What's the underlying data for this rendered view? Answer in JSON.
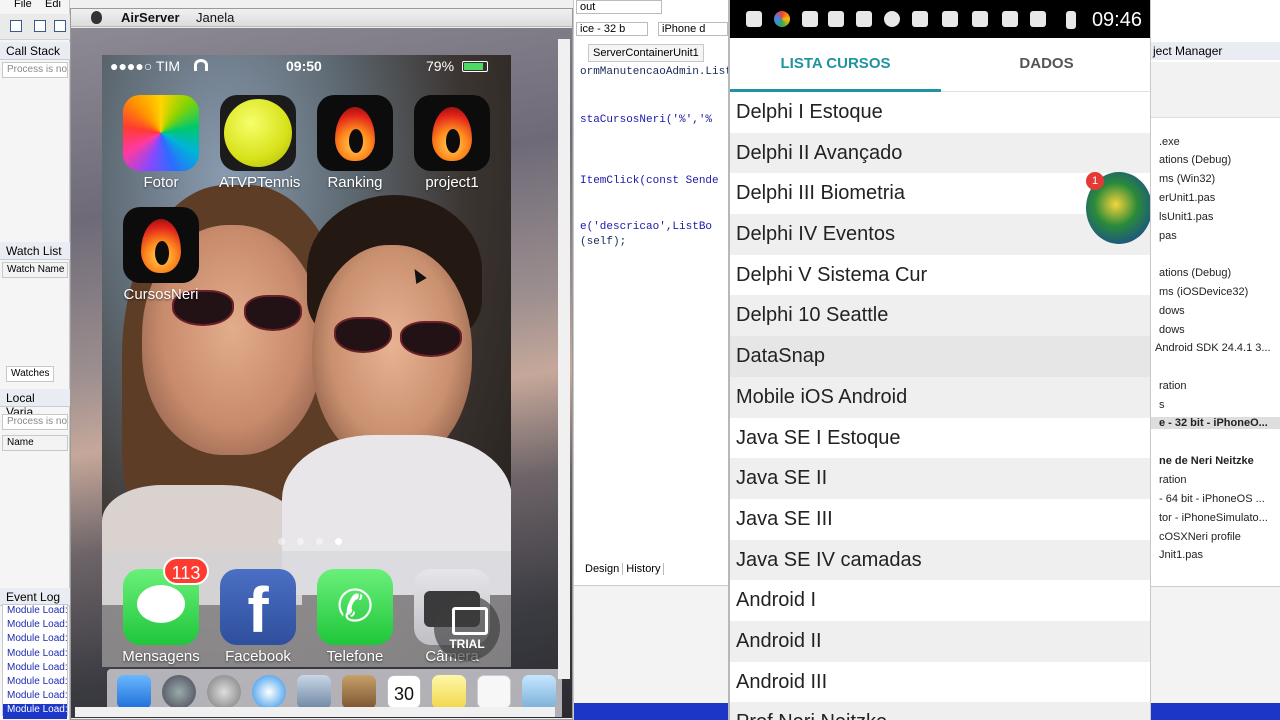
{
  "ide": {
    "menu": [
      "File",
      "Edi"
    ],
    "panels": {
      "call_stack": "Call Stack",
      "call_stack_sub": "Process is no",
      "watch_list": "Watch List",
      "watch_name": "Watch Name",
      "watches_tab": "Watches",
      "local_vars": "Local Varia",
      "local_vars_sub": "Process is no",
      "local_name": "Name",
      "event_log": "Event Log",
      "event_items": [
        "Module Load:",
        "Module Load:",
        "Module Load:",
        "Module Load:",
        "Module Load:",
        "Module Load:",
        "Module Load:",
        "Module Load:"
      ]
    },
    "center": {
      "combo1": "out",
      "combo2": "ice - 32 b",
      "combo3": "iPhone d",
      "tab": "ServerContainerUnit1",
      "code": [
        "ormManutencaoAdmin.ListBo",
        "staCursosNeri('%','%",
        "ItemClick(const Sende",
        "e('descricao',ListBo",
        "(self);"
      ],
      "design_tab": "Design",
      "history_tab": "History"
    },
    "project_manager": {
      "title": "ject Manager",
      "items": [
        ".exe",
        "ations (Debug)",
        "ms (Win32)",
        "erUnit1.pas",
        "lsUnit1.pas",
        "pas",
        "ations (Debug)",
        "ms (iOSDevice32)",
        "dows",
        "dows",
        "Android SDK 24.4.1 3...",
        "ration",
        "s",
        "e - 32 bit - iPhoneO...",
        "ne de Neri Neitzke",
        "ration",
        "- 64 bit - iPhoneOS ...",
        "tor - iPhoneSimulato...",
        "cOSXNeri profile",
        "Jnit1.pas"
      ]
    }
  },
  "airserver": {
    "app_name": "AirServer",
    "menu": "Janela",
    "status": {
      "carrier": "●●●●○ TIM",
      "time": "09:50",
      "battery": "79%"
    },
    "apps": [
      {
        "label": "Fotor",
        "icon": "fotor-icon"
      },
      {
        "label": "ATVPTennis",
        "icon": "tennis-ball-icon"
      },
      {
        "label": "Ranking",
        "icon": "flame-icon"
      },
      {
        "label": "project1",
        "icon": "flame-icon"
      },
      {
        "label": "CursosNeri",
        "icon": "flame-icon"
      }
    ],
    "dock": [
      {
        "label": "Mensagens",
        "icon": "messages-icon",
        "badge": "113"
      },
      {
        "label": "Facebook",
        "icon": "facebook-icon",
        "glyph": "f"
      },
      {
        "label": "Telefone",
        "icon": "phone-icon",
        "glyph": "✆"
      },
      {
        "label": "Câmera",
        "icon": "camera-icon"
      }
    ],
    "trial": "TRIAL",
    "mac_dock_calendar": "30"
  },
  "android": {
    "time": "09:46",
    "tabs": [
      "LISTA CURSOS",
      "DADOS"
    ],
    "courses": [
      "Delphi I Estoque",
      "Delphi II Avançado",
      "Delphi III Biometria",
      "Delphi IV Eventos",
      "Delphi V Sistema Cur",
      "Delphi 10 Seattle",
      "DataSnap",
      "Mobile iOS Android",
      "Java SE I Estoque",
      "Java SE II",
      "Java SE III",
      "Java SE IV camadas",
      "Android I",
      "Android II",
      "Android III",
      "Prof Neri Neitzke"
    ],
    "chat_badge": "1"
  },
  "colors": {
    "accent": "#1f93a0",
    "ide_blue": "#1c36c8",
    "badge": "#ff3b30"
  }
}
